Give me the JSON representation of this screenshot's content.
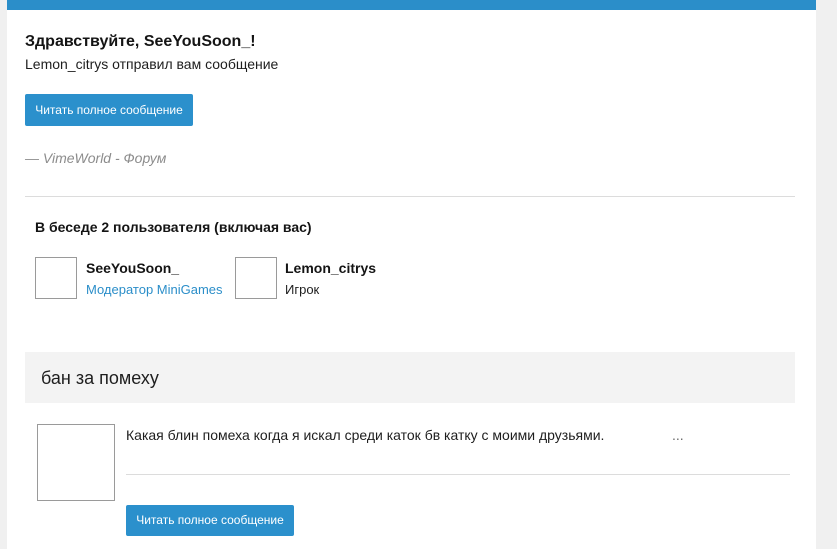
{
  "header": {
    "greeting": "Здравствуйте, SeeYouSoon_!",
    "notification": "Lemon_citrys отправил вам сообщение",
    "read_button": "Читать полное сообщение",
    "signature": "— VimeWorld - Форум"
  },
  "conversation": {
    "participants_title": "В беседе 2 пользователя (включая вас)",
    "participants": [
      {
        "name": "SeeYouSoon_",
        "role": "Модератор MiniGames"
      },
      {
        "name": "Lemon_citrys",
        "role": "Игрок"
      }
    ]
  },
  "message": {
    "subject": "бан за помеху",
    "text": "Какая блин помеха когда я искал среди каток бв катку с моими друзьями.",
    "ellipsis": "...",
    "read_button": "Читать полное сообщение"
  },
  "colors": {
    "accent": "#2b8ec9",
    "button": "#2b90cc",
    "subject_bg": "#f3f3f3"
  }
}
